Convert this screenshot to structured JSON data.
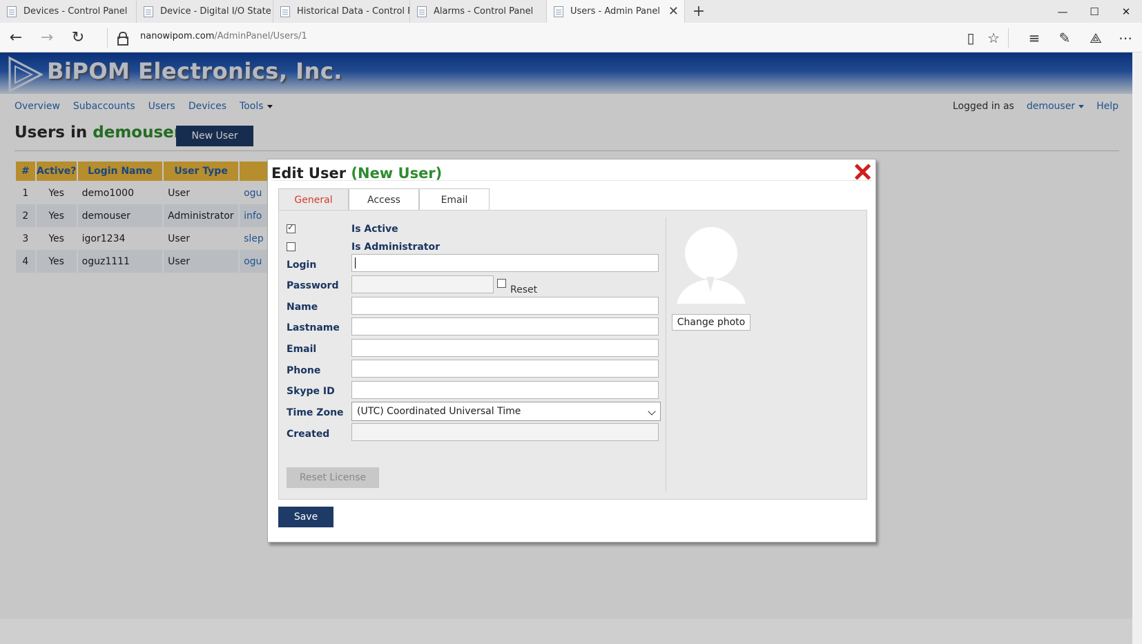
{
  "browser": {
    "tabs": [
      {
        "title": "Devices - Control Panel"
      },
      {
        "title": "Device - Digital I/O State"
      },
      {
        "title": "Historical Data - Control Pa"
      },
      {
        "title": "Alarms - Control Panel"
      },
      {
        "title": "Users - Admin Panel",
        "active": true
      }
    ],
    "new_tab_glyph": "+",
    "url_host": "nanowipom.com",
    "url_path": "/AdminPanel/Users/1"
  },
  "site": {
    "brand": "BiPOM Electronics, Inc.",
    "nav": [
      "Overview",
      "Subaccounts",
      "Users",
      "Devices",
      "Tools"
    ],
    "logged_in_label": "Logged in as",
    "username": "demouser",
    "help": "Help"
  },
  "page": {
    "title_prefix": "Users in",
    "title_account": "demouser",
    "new_user_button": "New User"
  },
  "users_table": {
    "headers": [
      "#",
      "Active?",
      "Login Name",
      "User Type",
      ""
    ],
    "rows": [
      {
        "num": "1",
        "active": "Yes",
        "login": "demo1000",
        "type": "User",
        "email": "ogu"
      },
      {
        "num": "2",
        "active": "Yes",
        "login": "demouser",
        "type": "Administrator",
        "email": "info"
      },
      {
        "num": "3",
        "active": "Yes",
        "login": "igor1234",
        "type": "User",
        "email": "slep"
      },
      {
        "num": "4",
        "active": "Yes",
        "login": "oguz1111",
        "type": "User",
        "email": "ogu"
      }
    ]
  },
  "modal": {
    "title": "Edit User",
    "subtitle": "(New User)",
    "tabs": [
      "General",
      "Access",
      "Email"
    ],
    "active_tab": "General",
    "is_active_label": "Is Active",
    "is_active_checked": true,
    "is_admin_label": "Is Administrator",
    "is_admin_checked": false,
    "fields": {
      "login": {
        "label": "Login",
        "value": ""
      },
      "password": {
        "label": "Password",
        "value": ""
      },
      "reset_label": "Reset",
      "name": {
        "label": "Name",
        "value": ""
      },
      "lastname": {
        "label": "Lastname",
        "value": ""
      },
      "email": {
        "label": "Email",
        "value": ""
      },
      "phone": {
        "label": "Phone",
        "value": ""
      },
      "skype": {
        "label": "Skype ID",
        "value": ""
      },
      "timezone": {
        "label": "Time Zone",
        "value": "(UTC) Coordinated Universal Time"
      },
      "created": {
        "label": "Created",
        "value": ""
      }
    },
    "reset_license_button": "Reset License",
    "change_photo_button": "Change photo",
    "save_button": "Save"
  },
  "colors": {
    "accent_green": "#2e8b2e",
    "link_blue": "#2a6ab8",
    "dark_button": "#1e3a66",
    "table_header": "#e9b63a",
    "close_red": "#d01e1e"
  }
}
